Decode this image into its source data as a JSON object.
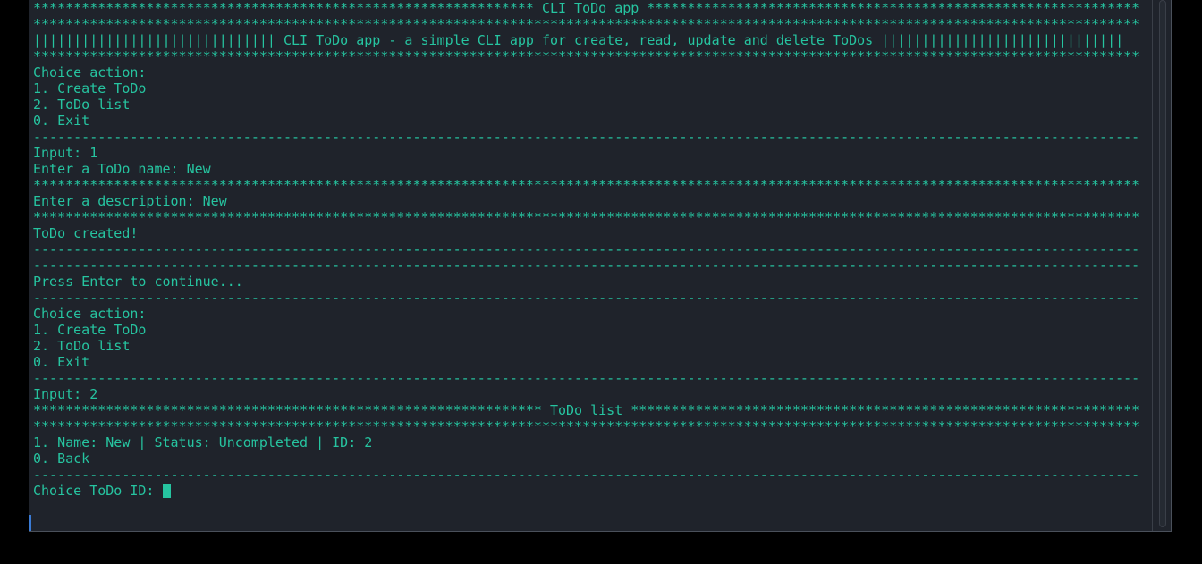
{
  "terminal": {
    "lines": [
      "************************************************************** CLI ToDo app *************************************************************",
      "*****************************************************************************************************************************************",
      "|||||||||||||||||||||||||||||| CLI ToDo app - a simple CLI app for create, read, update and delete ToDos ||||||||||||||||||||||||||||||",
      "*****************************************************************************************************************************************",
      "Choice action:",
      "1. Create ToDo",
      "2. ToDo list",
      "0. Exit",
      "-----------------------------------------------------------------------------------------------------------------------------------------",
      "Input: 1",
      "Enter a ToDo name: New",
      "*****************************************************************************************************************************************",
      "Enter a description: New",
      "*****************************************************************************************************************************************",
      "ToDo created!",
      "-----------------------------------------------------------------------------------------------------------------------------------------",
      "-----------------------------------------------------------------------------------------------------------------------------------------",
      "Press Enter to continue...",
      "-----------------------------------------------------------------------------------------------------------------------------------------",
      "Choice action:",
      "1. Create ToDo",
      "2. ToDo list",
      "0. Exit",
      "-----------------------------------------------------------------------------------------------------------------------------------------",
      "Input: 2",
      "*************************************************************** ToDo list ***************************************************************",
      "*****************************************************************************************************************************************",
      "1. Name: New | Status: Uncompleted | ID: 2",
      "0. Back",
      "-----------------------------------------------------------------------------------------------------------------------------------------"
    ],
    "prompt": "Choice ToDo ID: "
  },
  "colors": {
    "background": "#1f232b",
    "text": "#26c4a0",
    "outer": "#000000"
  }
}
